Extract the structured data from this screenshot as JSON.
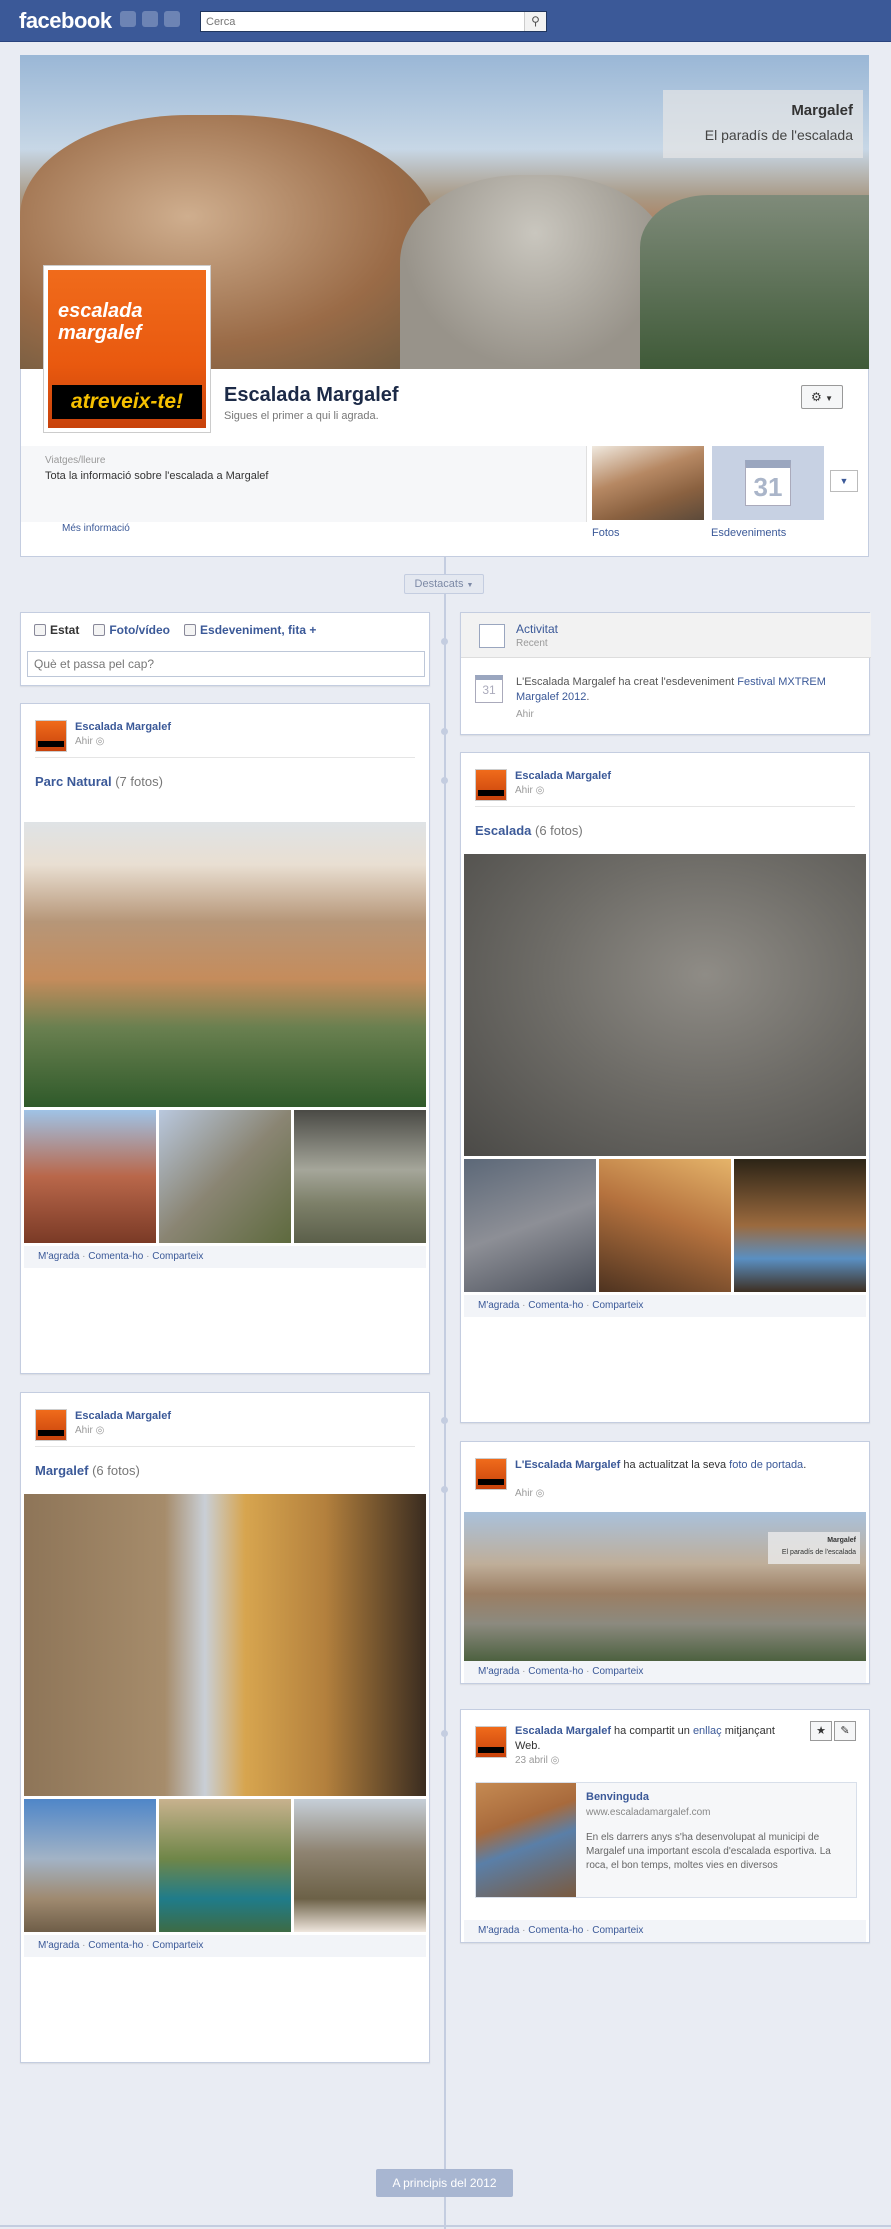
{
  "topbar": {
    "logo": "facebook",
    "search_placeholder": "Cerca"
  },
  "cover": {
    "caption_title": "Margalef",
    "caption_sub": "El paradís de l'escalada"
  },
  "profile": {
    "avatar_line1": "escalada",
    "avatar_line2": "margalef",
    "avatar_slogan": "atreveix-te!",
    "name": "Escalada Margalef",
    "sub": "Sigues el primer a qui li agrada.",
    "category": "Viatges/lleure",
    "description": "Tota la informació sobre l'escalada a Margalef",
    "more_info": "Més informació",
    "tab_photos": "Fotos",
    "tab_events": "Esdeveniments",
    "calendar_day": "31"
  },
  "timeline": {
    "highlights": "Destacats",
    "bottom_pill": "A principis del 2012"
  },
  "composer": {
    "tab_status": "Estat",
    "tab_photo": "Foto/vídeo",
    "tab_event": "Esdeveniment, fita +",
    "placeholder": "Què et passa pel cap?"
  },
  "activity": {
    "title": "Activitat",
    "sub": "Recent",
    "cal": "31",
    "text_pre": "L'Escalada Margalef ha creat l'esdeveniment ",
    "event_link": "Festival MXTREM Margalef 2012",
    "text_post": ".",
    "time": "Ahir"
  },
  "actions": {
    "like": "M'agrada",
    "comment": "Comenta-ho",
    "share": "Comparteix",
    "dot": "·"
  },
  "posts": {
    "p1": {
      "author": "Escalada Margalef",
      "time": "Ahir",
      "album": "Parc Natural",
      "count": "(7 fotos)"
    },
    "p2": {
      "author": "Escalada Margalef",
      "time": "Ahir",
      "album": "Escalada",
      "count": "(6 fotos)"
    },
    "p3": {
      "author": "Escalada Margalef",
      "time": "Ahir",
      "album": "Margalef",
      "count": "(6 fotos)"
    },
    "p4": {
      "author": "L'Escalada Margalef",
      "text": " ha actualitzat la seva ",
      "link": "foto de portada",
      "end": ".",
      "time": "Ahir",
      "mini_title": "Margalef",
      "mini_sub": "El paradís de l'escalada"
    },
    "p5": {
      "author": "Escalada Margalef",
      "text": " ha compartit un ",
      "link": "enllaç",
      "text2": " mitjançant Web.",
      "time": "23 abril",
      "link_title": "Benvinguda",
      "link_url": "www.escaladamargalef.com",
      "link_desc": "En els darrers anys s'ha desenvolupat al municipi de Margalef una important escola d'escalada esportiva. La roca, el bon temps, moltes vies en diversos"
    }
  },
  "icons": {
    "search": "search-icon",
    "gear": "gear-icon",
    "globe": "globe-icon",
    "star": "star-icon",
    "pencil": "pencil-icon",
    "chevron": "chevron-down-icon"
  },
  "colors": {
    "brand": "#3b5998",
    "avatar_orange": "#e9590f",
    "timeline": "#c4cde0"
  }
}
